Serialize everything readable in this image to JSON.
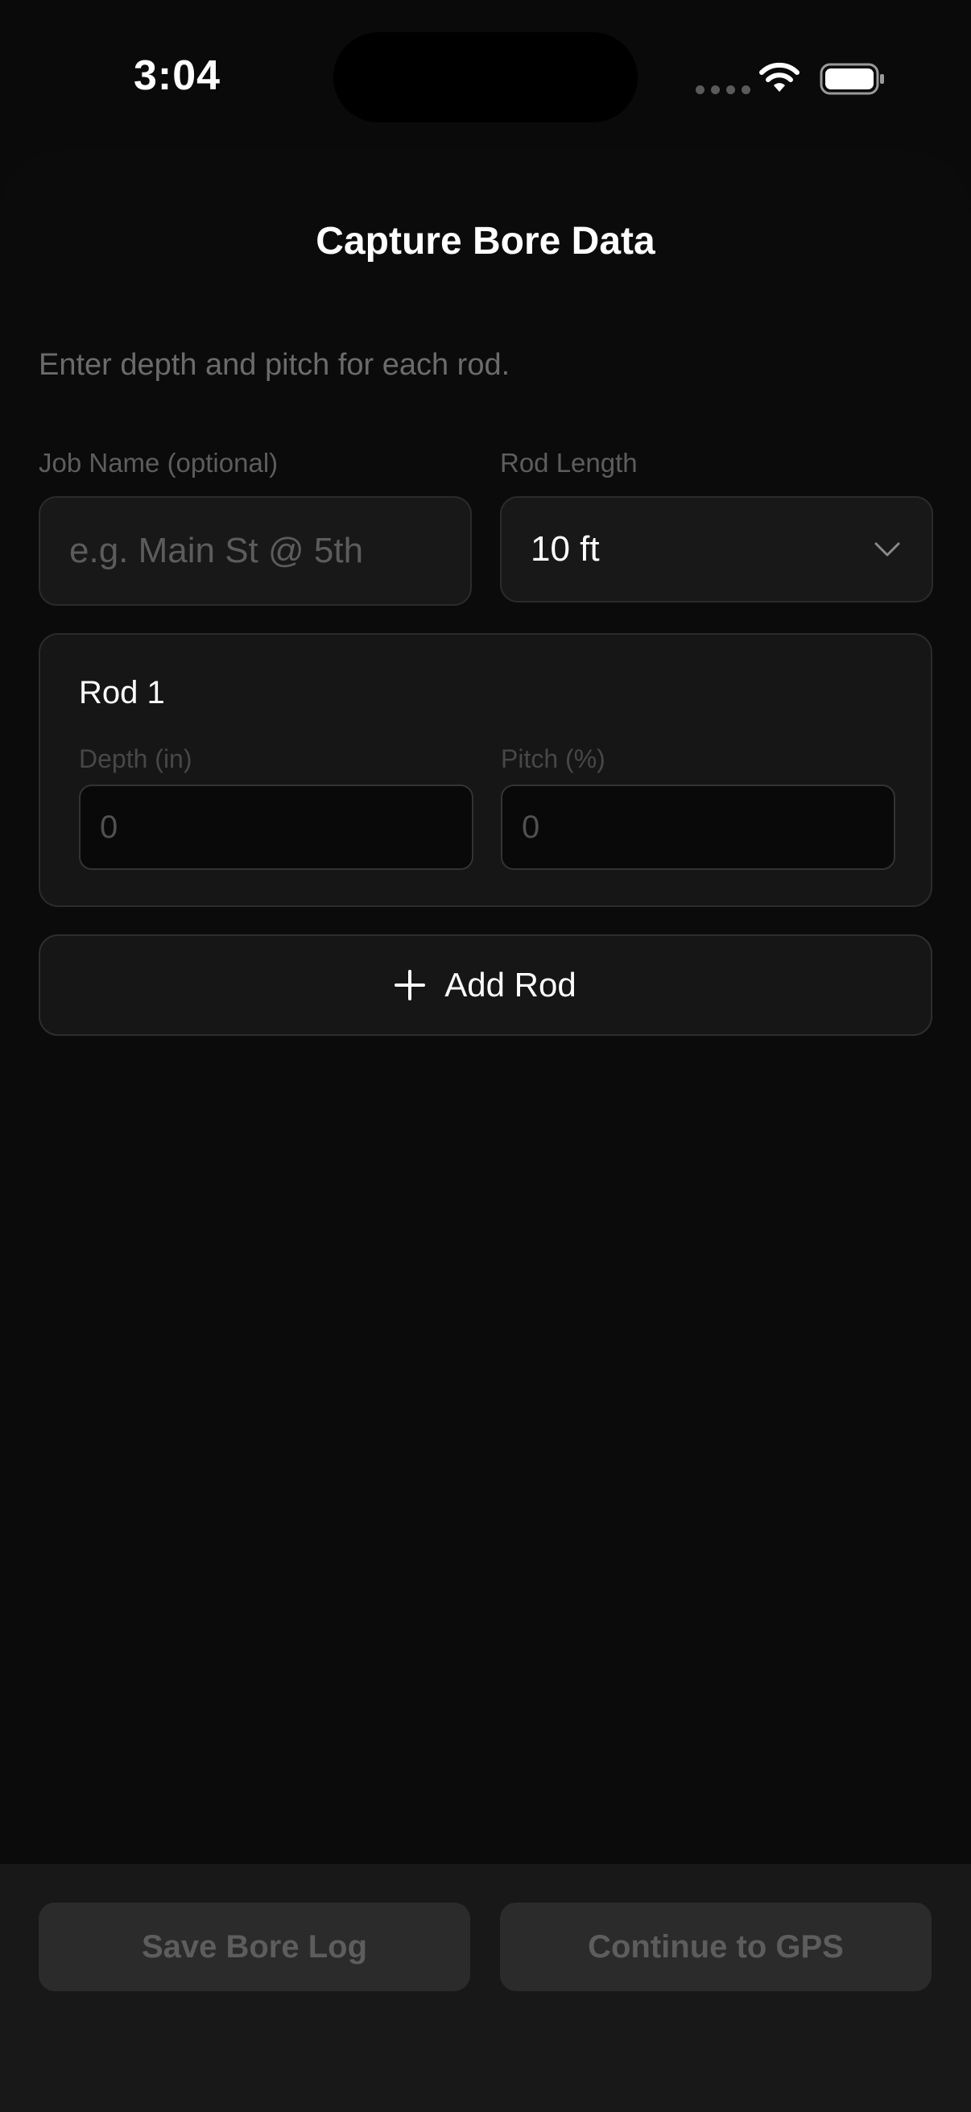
{
  "status_bar": {
    "time": "3:04"
  },
  "sheet": {
    "title": "Capture Bore Data",
    "subtitle": "Enter depth and pitch for each rod."
  },
  "job_name": {
    "label": "Job Name (optional)",
    "placeholder": "e.g. Main St @ 5th",
    "value": ""
  },
  "rod_length": {
    "label": "Rod Length",
    "selected": "10 ft"
  },
  "rods": [
    {
      "title": "Rod 1",
      "depth_label": "Depth (in)",
      "depth_placeholder": "0",
      "pitch_label": "Pitch (%)",
      "pitch_placeholder": "0"
    }
  ],
  "add_rod": {
    "label": "Add Rod",
    "icon": "plus-icon"
  },
  "actions": {
    "save_label": "Save Bore Log",
    "continue_label": "Continue to GPS"
  },
  "colors": {
    "background": "#0a0a0a",
    "card": "#161616",
    "disabled_button": "#2b2b2b"
  }
}
